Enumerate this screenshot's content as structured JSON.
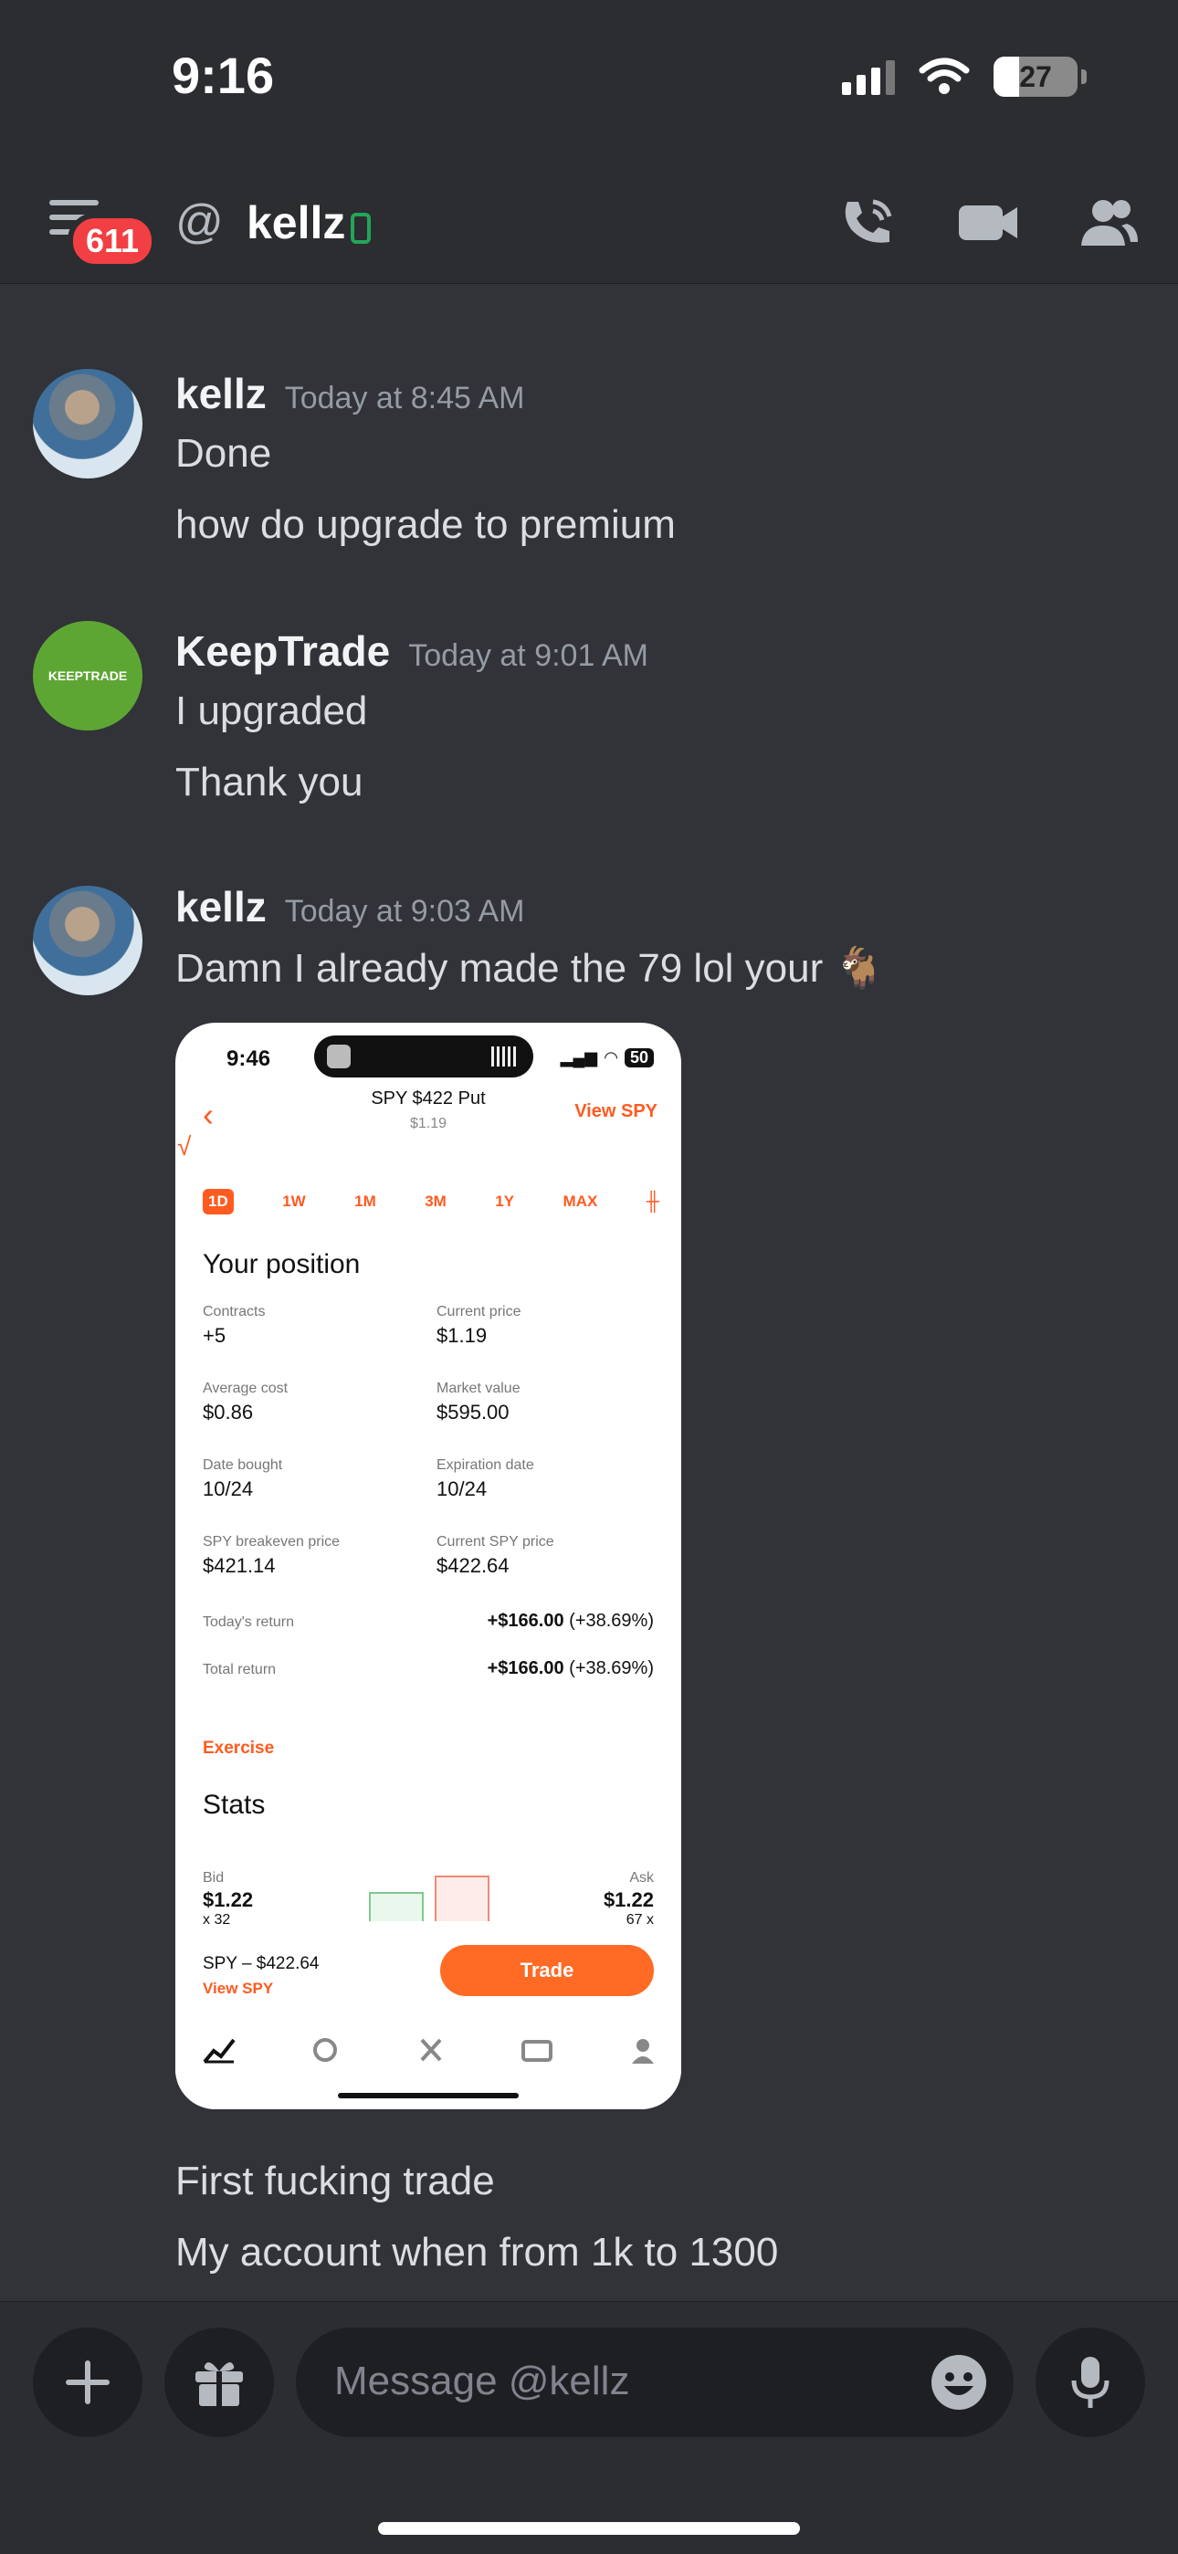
{
  "status_bar": {
    "time": "9:16",
    "battery": "27"
  },
  "header": {
    "unread_badge": "611",
    "at_symbol": "@",
    "channel": "kellz"
  },
  "messages": [
    {
      "author": "kellz",
      "timestamp": "Today at 8:45 AM",
      "lines": [
        "Done",
        "how do upgrade to premium"
      ]
    },
    {
      "author": "KeepTrade",
      "timestamp": "Today at 9:01 AM",
      "lines": [
        "I upgraded",
        "Thank you"
      ],
      "avatar_text": "KEEPTRADE"
    },
    {
      "author": "kellz",
      "timestamp": "Today at 9:03 AM",
      "lines": [
        "Damn I already made the 79 lol your 🐐"
      ],
      "after_image_lines": [
        "First fucking trade",
        "My account when from 1k to 1300"
      ]
    }
  ],
  "attachment": {
    "time": "9:46",
    "battery": "50",
    "title": "SPY $422 Put",
    "subtitle": "$1.19",
    "view_link": "View SPY",
    "ranges": [
      "1D",
      "1W",
      "1M",
      "3M",
      "1Y",
      "MAX"
    ],
    "section_position": "Your position",
    "fields": [
      {
        "label": "Contracts",
        "value": "+5"
      },
      {
        "label": "Current price",
        "value": "$1.19"
      },
      {
        "label": "Average cost",
        "value": "$0.86"
      },
      {
        "label": "Market value",
        "value": "$595.00"
      },
      {
        "label": "Date bought",
        "value": "10/24"
      },
      {
        "label": "Expiration date",
        "value": "10/24"
      },
      {
        "label": "SPY breakeven price",
        "value": "$421.14"
      },
      {
        "label": "Current SPY price",
        "value": "$422.64"
      }
    ],
    "returns": [
      {
        "label": "Today's return",
        "amount": "+$166.00",
        "pct": "(+38.69%)"
      },
      {
        "label": "Total return",
        "amount": "+$166.00",
        "pct": "(+38.69%)"
      }
    ],
    "exercise": "Exercise",
    "section_stats": "Stats",
    "bid": {
      "label": "Bid",
      "value": "$1.22",
      "size": "x 32"
    },
    "ask": {
      "label": "Ask",
      "value": "$1.22",
      "size": "67 x"
    },
    "spy_line": "SPY – $422.64",
    "spy_link": "View SPY",
    "trade_button": "Trade"
  },
  "composer": {
    "placeholder": "Message @kellz"
  },
  "colors": {
    "background": "#313338",
    "header": "#2b2d31",
    "accent": "#ff5a1f",
    "badge": "#f23f43",
    "online": "#23a55a"
  },
  "icons": [
    "hamburger-icon",
    "phone-icon",
    "video-icon",
    "members-icon",
    "plus-icon",
    "gift-icon",
    "emoji-icon",
    "mic-icon"
  ]
}
